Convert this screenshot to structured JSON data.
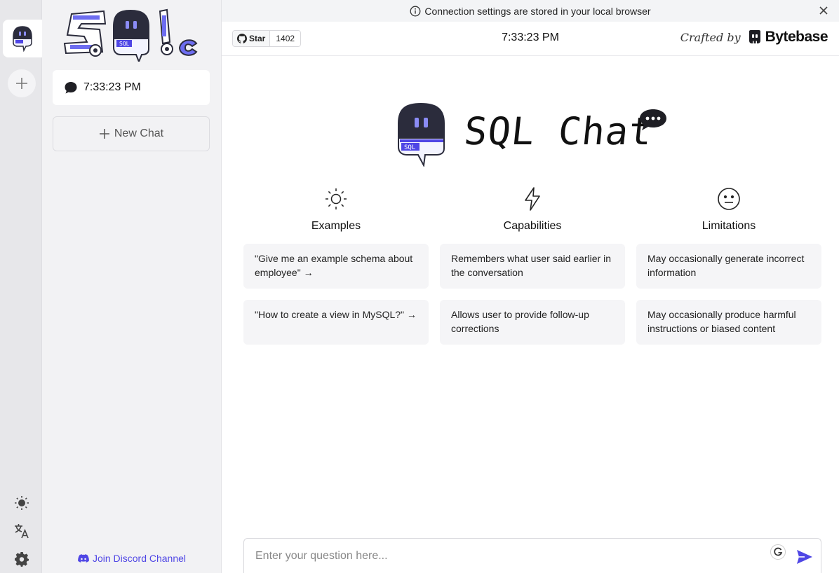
{
  "banner": {
    "text": "Connection settings are stored in your local browser"
  },
  "header": {
    "github_star_label": "Star",
    "github_star_count": "1402",
    "title": "7:33:23 PM",
    "crafted_by": "Crafted by",
    "brand": "Bytebase"
  },
  "sidebar": {
    "chats": [
      {
        "label": "7:33:23 PM"
      }
    ],
    "new_chat_label": "New Chat",
    "discord_label": "Join Discord Channel"
  },
  "hero": {
    "title": "SQL Chat"
  },
  "columns": [
    {
      "title": "Examples",
      "icon": "sun-icon",
      "items": [
        "\"Give me an example schema about employee\" →",
        "\"How to create a view in MySQL?\" →"
      ]
    },
    {
      "title": "Capabilities",
      "icon": "lightning-icon",
      "items": [
        "Remembers what user said earlier in the conversation",
        "Allows user to provide follow-up corrections"
      ]
    },
    {
      "title": "Limitations",
      "icon": "neutral-face-icon",
      "items": [
        "May occasionally generate incorrect information",
        "May occasionally produce harmful instructions or biased content"
      ]
    }
  ],
  "input": {
    "placeholder": "Enter your question here...",
    "value": ""
  },
  "colors": {
    "accent": "#4f46e5",
    "robot_body": "#2b2c3c",
    "sidebar_bg": "#f2f2f4",
    "rail_bg": "#e7e7ea"
  }
}
